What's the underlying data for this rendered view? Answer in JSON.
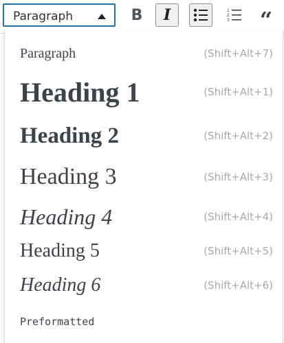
{
  "toolbar": {
    "format_select": {
      "value": "Paragraph"
    },
    "buttons": {
      "bold": "B",
      "italic": "I",
      "quote": "“"
    }
  },
  "format_menu": {
    "items": [
      {
        "label": "Paragraph",
        "shortcut": "(Shift+Alt+7)"
      },
      {
        "label": "Heading 1",
        "shortcut": "(Shift+Alt+1)"
      },
      {
        "label": "Heading 2",
        "shortcut": "(Shift+Alt+2)"
      },
      {
        "label": "Heading 3",
        "shortcut": "(Shift+Alt+3)"
      },
      {
        "label": "Heading 4",
        "shortcut": "(Shift+Alt+4)"
      },
      {
        "label": "Heading 5",
        "shortcut": "(Shift+Alt+5)"
      },
      {
        "label": "Heading 6",
        "shortcut": "(Shift+Alt+6)"
      },
      {
        "label": "Preformatted",
        "shortcut": ""
      }
    ]
  },
  "colors": {
    "accent": "#2271b1",
    "text": "#3c434a",
    "shortcut": "#a7aaad"
  }
}
